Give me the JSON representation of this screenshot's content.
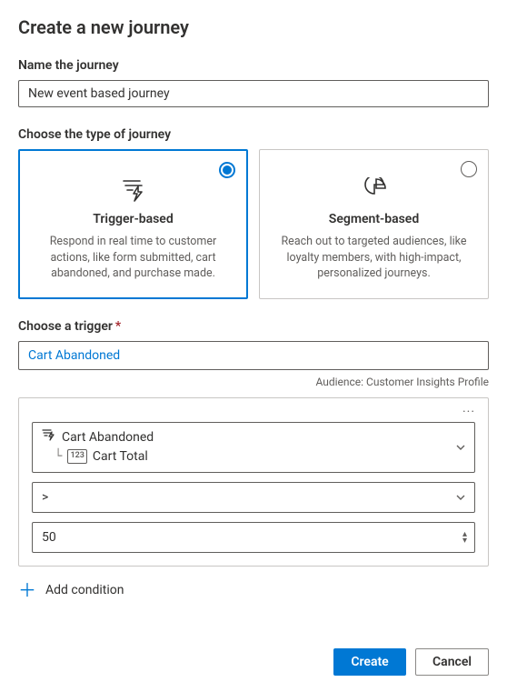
{
  "title": "Create a new journey",
  "name_field": {
    "label": "Name the journey",
    "value": "New event based journey"
  },
  "journey_type": {
    "label": "Choose the type of journey",
    "options": [
      {
        "title": "Trigger-based",
        "description": "Respond in real time to customer actions, like form submitted, cart abandoned, and purchase made.",
        "selected": true
      },
      {
        "title": "Segment-based",
        "description": "Reach out to targeted audiences, like loyalty members, with high-impact, personalized journeys.",
        "selected": false
      }
    ]
  },
  "trigger": {
    "label": "Choose a trigger",
    "value": "Cart Abandoned",
    "audience_label": "Audience:",
    "audience_value": "Customer Insights Profile"
  },
  "condition": {
    "attribute_root": "Cart Abandoned",
    "attribute_child": "Cart Total",
    "operator": ">",
    "value": "50"
  },
  "add_condition_label": "Add condition",
  "buttons": {
    "create": "Create",
    "cancel": "Cancel"
  }
}
